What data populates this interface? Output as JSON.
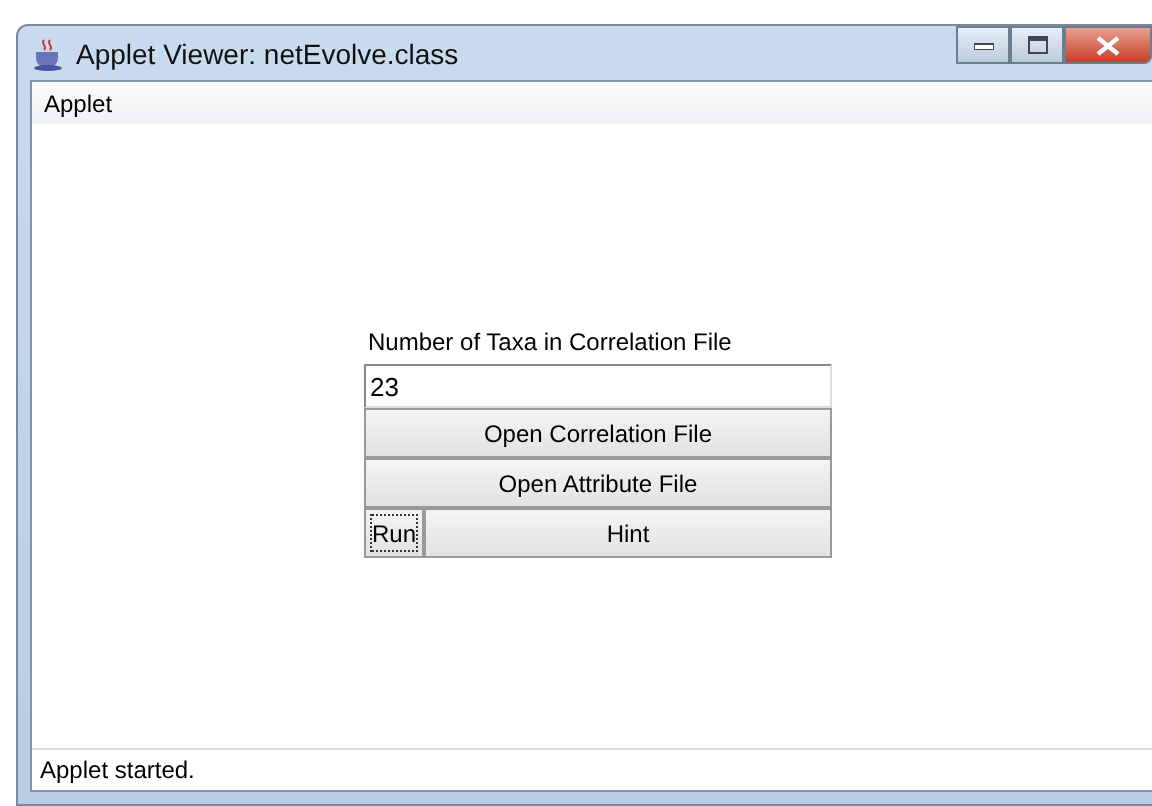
{
  "window": {
    "title": "Applet Viewer: netEvolve.class"
  },
  "menu": [
    "Applet"
  ],
  "panel": {
    "label": "Number of Taxa in Correlation File",
    "field": {
      "value": "23"
    },
    "buttons": [
      {
        "label": "Open Correlation File",
        "focused": false
      },
      {
        "label": "Open Attribute File",
        "focused": false
      }
    ],
    "bottom_buttons": [
      {
        "label": "Run",
        "focused": true
      },
      {
        "label": "Hint",
        "focused": false
      }
    ]
  },
  "status_bar": "Applet started."
}
